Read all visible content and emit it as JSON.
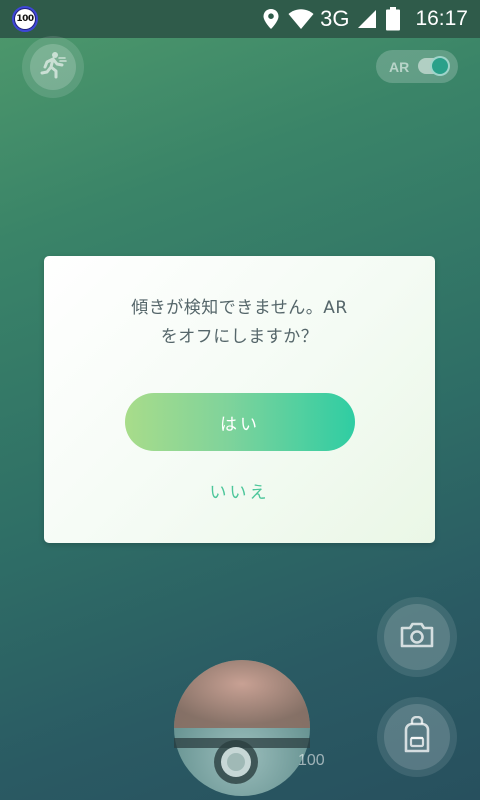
{
  "status_bar": {
    "badge_text": "100",
    "network": "3G",
    "time": "16:17",
    "icons": [
      "location-icon",
      "wifi-icon",
      "cell-signal-icon",
      "battery-icon"
    ]
  },
  "top": {
    "run_icon": "running-man-icon",
    "ar_label": "AR",
    "ar_enabled": true
  },
  "dialog": {
    "message_lines": [
      "傾きが検知できません。AR",
      "をオフにしますか？"
    ],
    "yes_label": "はい",
    "no_label": "いいえ"
  },
  "side_buttons": {
    "camera_icon": "camera-icon",
    "bag_icon": "backpack-icon"
  },
  "pokeball": {
    "count": "100"
  },
  "colors": {
    "status_bar_bg": "#2f5b4a",
    "yes_gradient_start": "#a8dc8a",
    "yes_gradient_end": "#2fcda3",
    "no_text": "#4cc69a",
    "message_text": "#55666a"
  }
}
